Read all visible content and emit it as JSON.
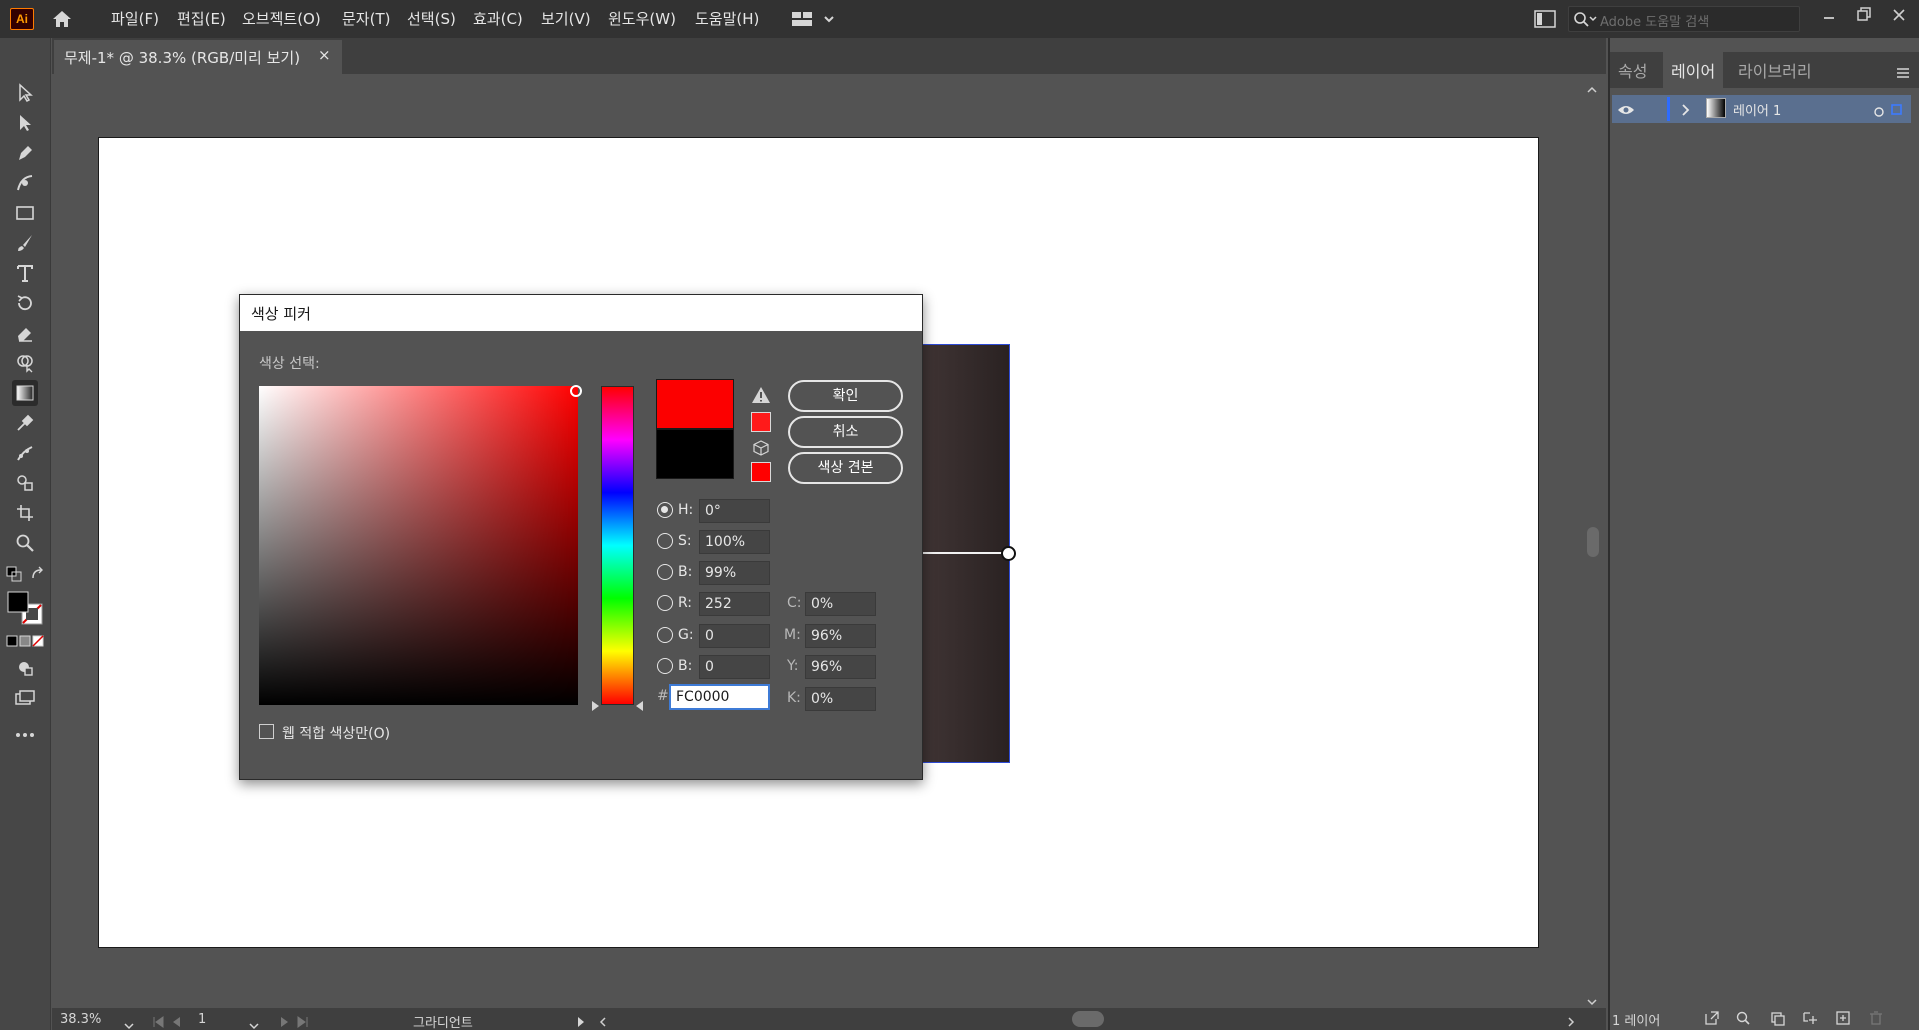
{
  "app": {
    "logo": "Ai",
    "menu": [
      "파일(F)",
      "편집(E)",
      "오브젝트(O)",
      "문자(T)",
      "선택(S)",
      "효과(C)",
      "보기(V)",
      "윈도우(W)",
      "도움말(H)"
    ],
    "search_placeholder": "Adobe 도움말 검색"
  },
  "document": {
    "tab_title": "무제-1* @ 38.3% (RGB/미리 보기)",
    "close": "×"
  },
  "status": {
    "zoom": "38.3%",
    "page": "1",
    "tool_name": "그라디언트"
  },
  "right_panel": {
    "tabs": [
      "속성",
      "레이어",
      "라이브러리"
    ],
    "active_tab": "레이어",
    "layer_name": "레이어 1",
    "layer_count": "1 레이어"
  },
  "color_picker": {
    "title": "색상 피커",
    "select_label": "색상 선택:",
    "web_only_label": "웹 적합 색상만(O)",
    "buttons": {
      "ok": "확인",
      "cancel": "취소",
      "swatches": "색상 견본"
    },
    "new_color": "#fc0000",
    "old_color": "#000000",
    "hsb": {
      "h_label": "H:",
      "h": "0°",
      "s_label": "S:",
      "s": "100%",
      "b_label": "B:",
      "b": "99%"
    },
    "rgb": {
      "r_label": "R:",
      "r": "252",
      "g_label": "G:",
      "g": "0",
      "b_label": "B:",
      "b": "0"
    },
    "cmyk": {
      "c_label": "C:",
      "c": "0%",
      "m_label": "M:",
      "m": "96%",
      "y_label": "Y:",
      "y": "96%",
      "k_label": "K:",
      "k": "0%"
    },
    "hex_label": "#",
    "hex": "FC0000"
  }
}
